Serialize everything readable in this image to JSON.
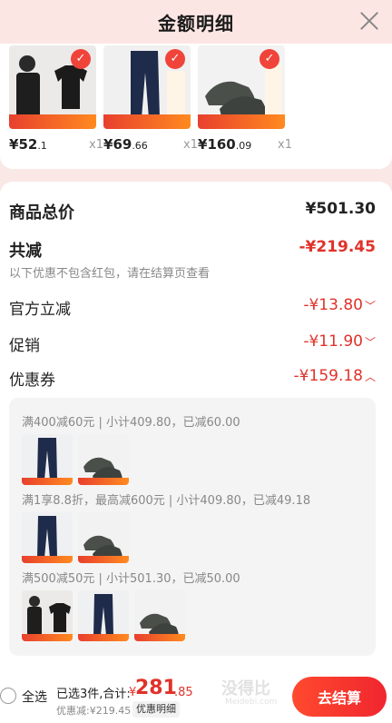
{
  "header": {
    "title": "金额明细"
  },
  "products": [
    {
      "currency": "¥",
      "price_int": "52",
      "price_dec": ".1",
      "qty": "x1"
    },
    {
      "currency": "¥",
      "price_int": "69",
      "price_dec": ".66",
      "qty": "x1"
    },
    {
      "currency": "¥",
      "price_int": "160",
      "price_dec": ".09",
      "qty": "x1"
    }
  ],
  "summary": {
    "total_label": "商品总价",
    "total_value": "¥501.30",
    "reduce_label": "共减",
    "reduce_value": "-¥219.45",
    "note": "以下优惠不包含红包，请在结算页查看",
    "official_label": "官方立减",
    "official_value": "-¥13.80",
    "promo_label": "促销",
    "promo_value": "-¥11.90",
    "coupon_label": "优惠券",
    "coupon_value": "-¥159.18"
  },
  "coupons": [
    {
      "text": "满400减60元 | 小计409.80，已减60.00"
    },
    {
      "text": "满1享8.8折，最高减600元 | 小计409.80，已减49.18"
    },
    {
      "text": "满500减50元 | 小计501.30，已减50.00"
    }
  ],
  "footer": {
    "select_all": "全选",
    "selected": "已选3件,合计:",
    "currency": "¥",
    "total_int": "281",
    "total_dec": ".85",
    "discount": "优惠减:¥219.45",
    "detail_button": "优惠明细",
    "checkout_button": "去结算",
    "watermark_main": "没得比",
    "watermark_sub": "Meidebi.com"
  }
}
